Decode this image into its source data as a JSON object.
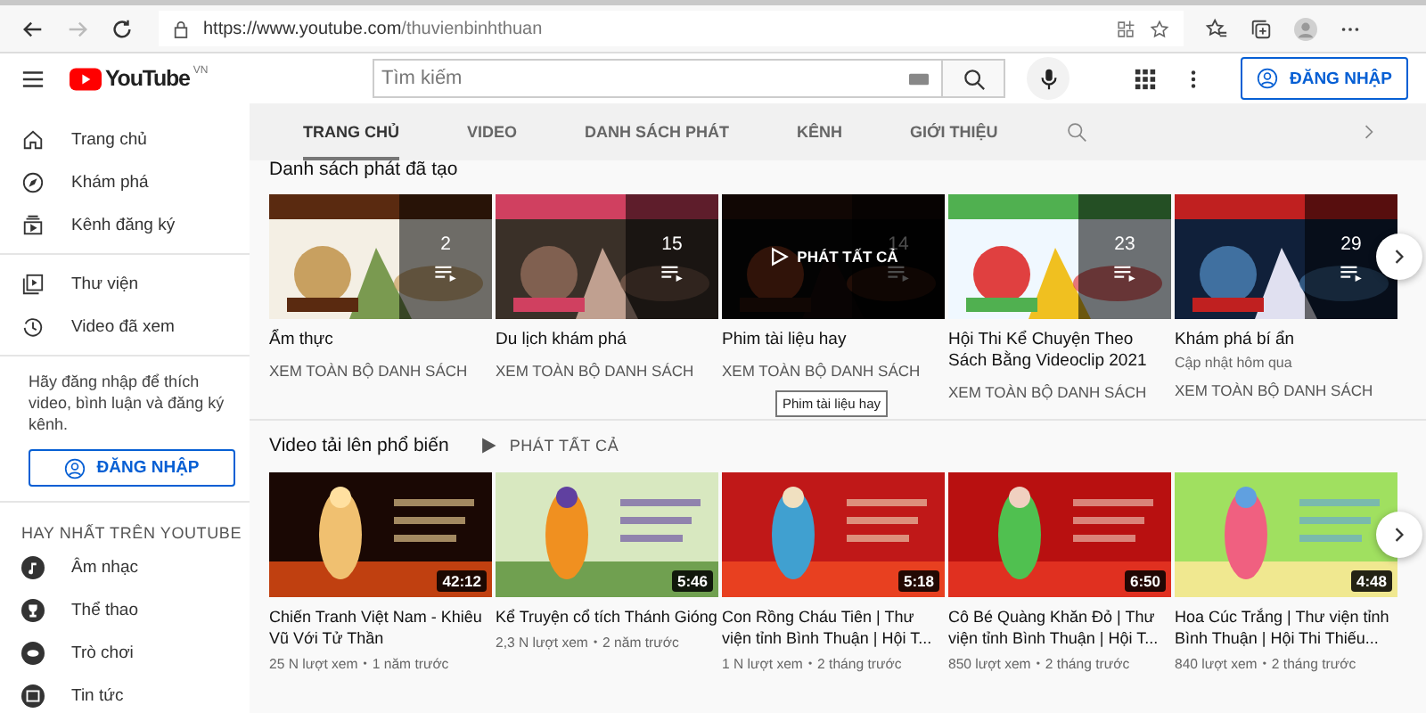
{
  "browser": {
    "url_host": "https://www.youtube.com",
    "url_path": "/thuvienbinhthuan"
  },
  "header": {
    "logo": "YouTube",
    "region": "VN",
    "search": {
      "placeholder": "Tìm kiếm"
    },
    "sign_in": "ĐĂNG NHẬP"
  },
  "sidebar": {
    "items": [
      {
        "label": "Trang chủ"
      },
      {
        "label": "Khám phá"
      },
      {
        "label": "Kênh đăng ký"
      }
    ],
    "items2": [
      {
        "label": "Thư viện"
      },
      {
        "label": "Video đã xem"
      }
    ],
    "prompt": "Hãy đăng nhập để thích video, bình luận và đăng ký kênh.",
    "sign_in": "ĐĂNG NHẬP",
    "best_heading": "HAY NHẤT TRÊN YOUTUBE",
    "best": [
      {
        "label": "Âm nhạc"
      },
      {
        "label": "Thể thao"
      },
      {
        "label": "Trò chơi"
      },
      {
        "label": "Tin tức"
      }
    ]
  },
  "channel_tabs": [
    {
      "label": "TRANG CHỦ",
      "selected": true
    },
    {
      "label": "VIDEO",
      "selected": false
    },
    {
      "label": "DANH SÁCH PHÁT",
      "selected": false
    },
    {
      "label": "KÊNH",
      "selected": false
    },
    {
      "label": "GIỚI THIỆU",
      "selected": false
    }
  ],
  "playlists": {
    "title": "Danh sách phát đã tạo",
    "play_all": "PHÁT TẤT CẢ",
    "tooltip": "Phim tài liệu hay",
    "cards": [
      {
        "title": "Ẩm thực",
        "count": "2",
        "link": "XEM TOÀN BỘ DANH SÁCH",
        "hovered": false
      },
      {
        "title": "Du lịch khám phá",
        "count": "15",
        "link": "XEM TOÀN BỘ DANH SÁCH",
        "hovered": false
      },
      {
        "title": "Phim tài liệu hay",
        "count": "14",
        "link": "XEM TOÀN BỘ DANH SÁCH",
        "hovered": true
      },
      {
        "title": "Hội Thi Kể Chuyện Theo Sách Bằng Videoclip 2021",
        "count": "23",
        "link": "XEM TOÀN BỘ DANH SÁCH",
        "hovered": false
      },
      {
        "title": "Khám phá bí ẩn",
        "count": "29",
        "updated": "Cập nhật hôm qua",
        "link": "XEM TOÀN BỘ DANH SÁCH",
        "hovered": false
      }
    ]
  },
  "uploads": {
    "title": "Video tải lên phổ biến",
    "play_all": "PHÁT TẤT CẢ",
    "separator": "•",
    "videos": [
      {
        "title": "Chiến Tranh Việt Nam - Khiêu Vũ Với Tử Thần",
        "duration": "42:12",
        "views": "25 N lượt xem",
        "age": "1 năm trước"
      },
      {
        "title": "Kể Truyện cổ tích Thánh Gióng",
        "duration": "5:46",
        "views": "2,3 N lượt xem",
        "age": "2 năm trước"
      },
      {
        "title": "Con Rồng Cháu Tiên | Thư viện tỉnh Bình Thuận | Hội T...",
        "duration": "5:18",
        "views": "1 N lượt xem",
        "age": "2 tháng trước"
      },
      {
        "title": "Cô Bé Quàng Khăn Đỏ | Thư viện tỉnh Bình Thuận | Hội T...",
        "duration": "6:50",
        "views": "850 lượt xem",
        "age": "2 tháng trước"
      },
      {
        "title": "Hoa Cúc Trắng | Thư viện tỉnh Bình Thuận | Hội Thi Thiếu...",
        "duration": "4:48",
        "views": "840 lượt xem",
        "age": "2 tháng trước"
      }
    ]
  }
}
